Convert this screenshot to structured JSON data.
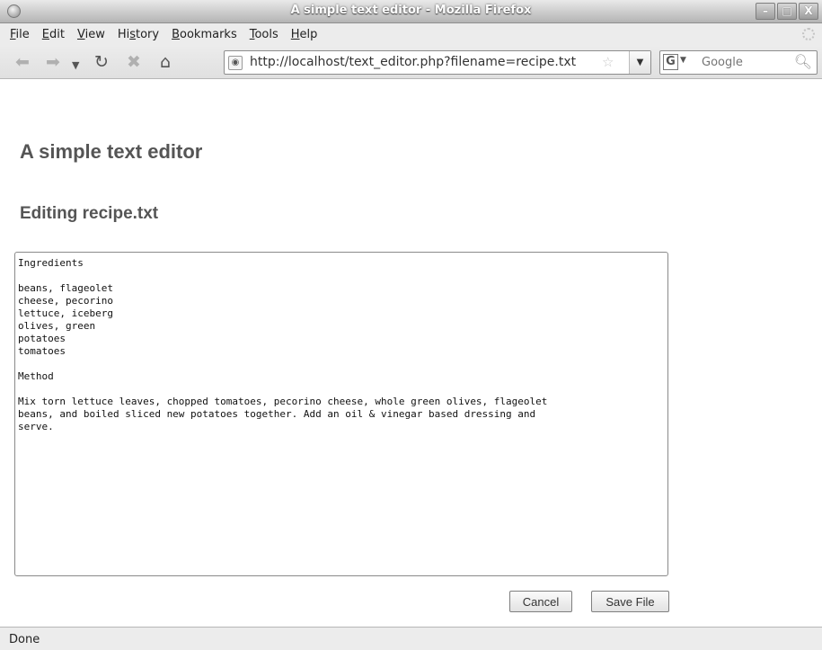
{
  "window": {
    "title": "A simple text editor - Mozilla Firefox",
    "buttons": {
      "minimize": "–",
      "maximize": "□",
      "close": "X"
    }
  },
  "menu": {
    "items": [
      {
        "label": "File",
        "accel": "F",
        "rest": "ile"
      },
      {
        "label": "Edit",
        "accel": "E",
        "rest": "dit"
      },
      {
        "label": "View",
        "accel": "V",
        "rest": "iew"
      },
      {
        "label": "History",
        "pre": "Hi",
        "accel": "s",
        "rest": "tory"
      },
      {
        "label": "Bookmarks",
        "accel": "B",
        "rest": "ookmarks"
      },
      {
        "label": "Tools",
        "accel": "T",
        "rest": "ools"
      },
      {
        "label": "Help",
        "accel": "H",
        "rest": "elp"
      }
    ]
  },
  "navbar": {
    "url": "http://localhost/text_editor.php?filename=recipe.txt",
    "search_placeholder": "Google",
    "search_engine_letter": "G",
    "icons": [
      "back-icon",
      "forward-icon",
      "history-dropdown-icon",
      "reload-icon",
      "stop-icon",
      "home-icon",
      "site-identity-icon",
      "bookmark-star-icon",
      "url-dropdown-icon",
      "search-engine-icon",
      "magnifier-icon"
    ]
  },
  "page": {
    "heading": "A simple text editor",
    "subheading": "Editing recipe.txt",
    "file_content": "Ingredients\n\nbeans, flageolet\ncheese, pecorino\nlettuce, iceberg\nolives, green\npotatoes\ntomatoes\n\nMethod\n\nMix torn lettuce leaves, chopped tomatoes, pecorino cheese, whole green olives, flageolet\nbeans, and boiled sliced new potatoes together. Add an oil & vinegar based dressing and\nserve.",
    "cancel_label": "Cancel",
    "save_label": "Save File"
  },
  "status": {
    "text": "Done"
  }
}
